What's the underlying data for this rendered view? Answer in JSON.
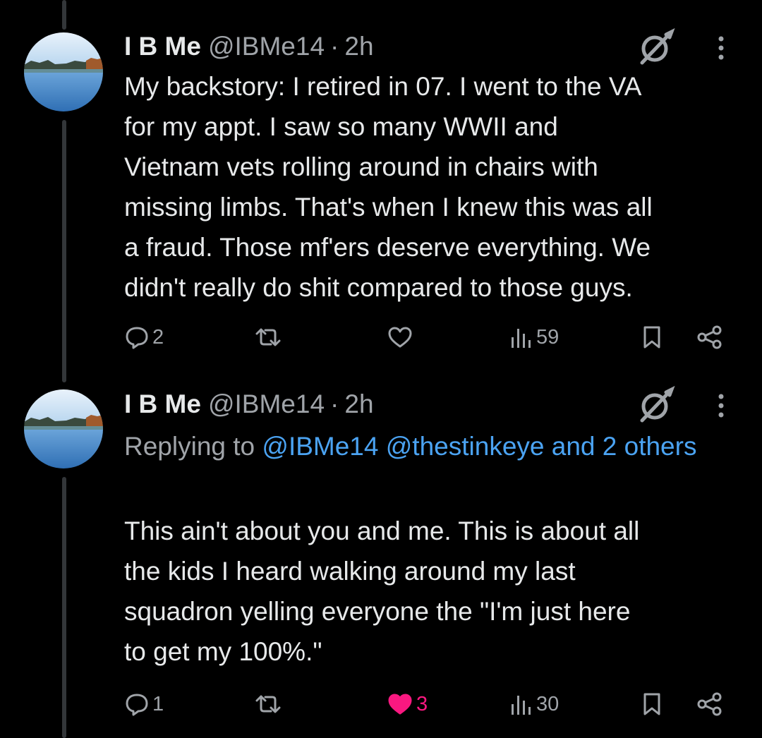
{
  "tweets": [
    {
      "author": {
        "name": "I B Me",
        "handle": "@IBMe14",
        "time": "2h",
        "separator": "·"
      },
      "text": "My backstory: I retired in 07. I went to the VA\nfor my appt. I saw so many WWII and\nVietnam vets rolling around in chairs with\nmissing limbs. That's when I knew this was all\na fraud. Those mf'ers deserve everything. We\ndidn't really do shit compared to those guys.",
      "actions": {
        "replies": "2",
        "reposts": "",
        "likes": "",
        "liked": false,
        "views": "59"
      }
    },
    {
      "author": {
        "name": "I B Me",
        "handle": "@IBMe14",
        "time": "2h",
        "separator": "·"
      },
      "reply_to": {
        "prefix": "Replying to",
        "mentions": "@IBMe14 @thestinkeye and 2 others"
      },
      "text": "This ain't about you and me. This is about all\nthe kids I heard walking around my last\nsquadron yelling everyone the \"I'm just here\nto get my 100%.\"",
      "actions": {
        "replies": "1",
        "reposts": "",
        "likes": "3",
        "liked": true,
        "views": "30"
      }
    }
  ],
  "colors": {
    "background": "#000000",
    "text_primary": "#e7e9ea",
    "text_secondary": "#a0a4a9",
    "link": "#4ba3f2",
    "like_active": "#f91880",
    "thread_line": "#333639"
  },
  "icons": [
    "reply-icon",
    "repost-icon",
    "like-icon",
    "views-icon",
    "bookmark-icon",
    "share-icon",
    "grok-icon",
    "more-icon"
  ]
}
